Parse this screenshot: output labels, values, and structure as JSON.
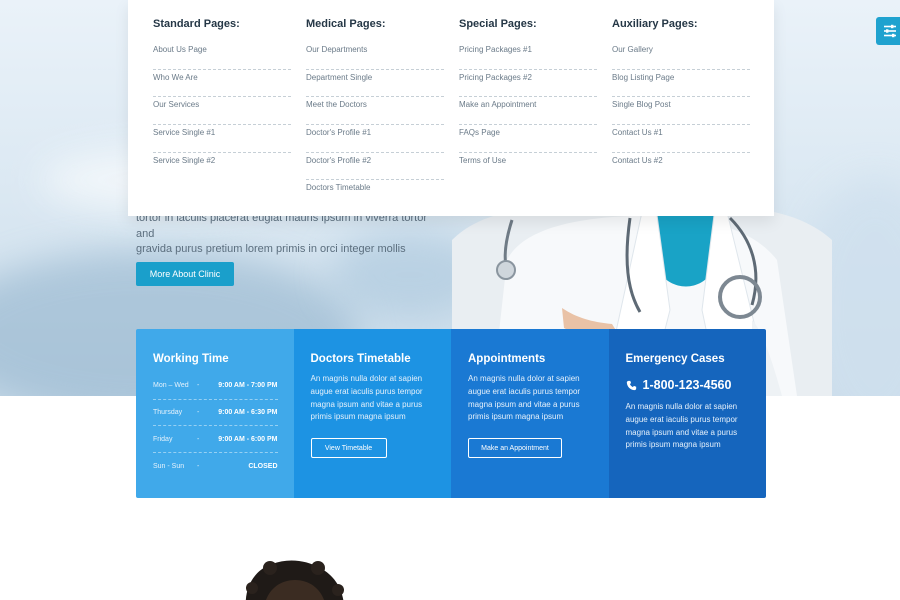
{
  "hero": {
    "text_line1": "tortor in iaculis placerat eugiat mauris ipsum in viverra tortor and",
    "text_line2": "gravida purus pretium lorem primis in orci integer mollis",
    "button_label": "More About Clinic"
  },
  "menu": {
    "columns": [
      {
        "title": "Standard Pages:",
        "items": [
          "About Us Page",
          "Who We Are",
          "Our Services",
          "Service Single #1",
          "Service Single #2"
        ]
      },
      {
        "title": "Medical Pages:",
        "items": [
          "Our Departments",
          "Department Single",
          "Meet the Doctors",
          "Doctor's Profile #1",
          "Doctor's Profile #2",
          "Doctors Timetable"
        ]
      },
      {
        "title": "Special Pages:",
        "items": [
          "Pricing Packages #1",
          "Pricing Packages #2",
          "Make an Appointment",
          "FAQs Page",
          "Terms of Use"
        ]
      },
      {
        "title": "Auxiliary Pages:",
        "items": [
          "Our Gallery",
          "Blog Listing Page",
          "Single Blog Post",
          "Contact Us #1",
          "Contact Us #2"
        ]
      }
    ]
  },
  "info": {
    "working_time": {
      "title": "Working Time",
      "rows": [
        {
          "day": "Mon – Wed",
          "sep": "-",
          "hours": "9:00 AM - 7:00 PM"
        },
        {
          "day": "Thursday",
          "sep": "-",
          "hours": "9:00 AM - 6:30 PM"
        },
        {
          "day": "Friday",
          "sep": "-",
          "hours": "9:00 AM - 6:00 PM"
        },
        {
          "day": "Sun - Sun",
          "sep": "-",
          "hours": "CLOSED"
        }
      ]
    },
    "timetable": {
      "title": "Doctors Timetable",
      "text": "An magnis nulla dolor at sapien augue erat iaculis purus tempor magna ipsum and vitae a purus primis ipsum magna ipsum",
      "button": "View Timetable"
    },
    "appointments": {
      "title": "Appointments",
      "text": "An magnis nulla dolor at sapien augue erat iaculis purus tempor magna ipsum and vitae a purus primis ipsum magna ipsum",
      "button": "Make an Appointment"
    },
    "emergency": {
      "title": "Emergency Cases",
      "phone": "1-800-123-4560",
      "text": "An magnis nulla dolor at sapien augue erat iaculis purus tempor magna ipsum and vitae a purus primis ipsum magna ipsum"
    }
  },
  "icons": {
    "side_toggle": "sliders-icon",
    "phone": "phone-icon"
  },
  "colors": {
    "accent": "#1a9fcb",
    "panel_1": "#40a9ea",
    "panel_2": "#1d93e3",
    "panel_3": "#1a79d3",
    "panel_4": "#1565bd"
  }
}
